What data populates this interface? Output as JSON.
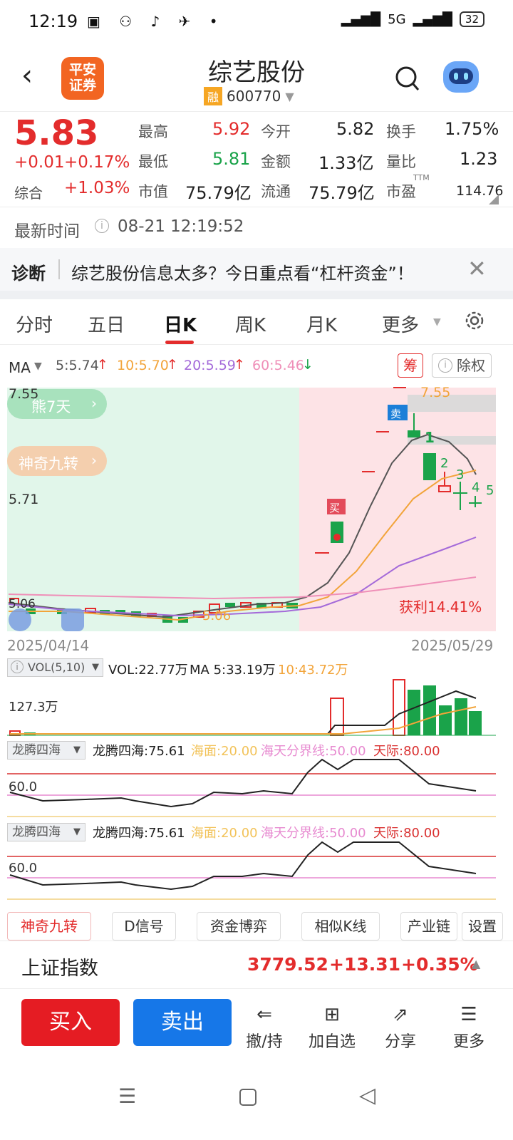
{
  "status_bar": {
    "time": "12:19",
    "network": "5G",
    "battery": "32"
  },
  "header": {
    "logo_text": "平安\n证券",
    "title": "综艺股份",
    "margin_tag": "融",
    "code": "600770"
  },
  "quote": {
    "price": "5.83",
    "change": "+0.01",
    "change_pct": "+0.17%",
    "composite_label": "综合",
    "composite_value": "+1.03%",
    "high_label": "最高",
    "high": "5.92",
    "low_label": "最低",
    "low": "5.81",
    "mktcap_label": "市值",
    "mktcap": "75.79亿",
    "open_label": "今开",
    "open": "5.82",
    "amount_label": "金额",
    "amount": "1.33亿",
    "float_label": "流通",
    "float_cap": "75.79亿",
    "turnover_label": "换手",
    "turnover": "1.75%",
    "volratio_label": "量比",
    "volratio": "1.23",
    "pe_label": "市盈",
    "pe_sup": "TTM",
    "pe": "114.76"
  },
  "latest_time": {
    "label": "最新时间",
    "value": "08-21 12:19:52"
  },
  "diagnosis": {
    "label": "诊断",
    "text": "综艺股份信息太多？今日重点看“杠杆资金”！"
  },
  "tabs": [
    "分时",
    "五日",
    "日K",
    "周K",
    "月K",
    "更多"
  ],
  "active_tab": "日K",
  "ma_row": {
    "label": "MA",
    "ma5": "5:5.74",
    "ma10": "10:5.70",
    "ma20": "20:5.59",
    "ma60": "60:5.46",
    "chou_label": "筹",
    "adjust_label": "除权"
  },
  "kline": {
    "high_label": "7.55",
    "mid_label": "5.71",
    "low_label": "5.06",
    "bear_tag": "熊7天",
    "nine_tag": "神奇九转",
    "buy_tag": "买",
    "sell_tag": "卖",
    "profit_text": "获利14.41%",
    "peak_label": "7.55",
    "low_point_label": "5.06",
    "counts": [
      "1",
      "2",
      "3",
      "4",
      "5"
    ],
    "date_start": "2025/04/14",
    "date_end": "2025/05/29"
  },
  "volume": {
    "selector": "VOL(5,10)",
    "vol": "VOL:22.77万",
    "ma5": "MA 5:33.19万",
    "ma10": "10:43.72万",
    "axis_label": "127.3万"
  },
  "indicator": {
    "selector": "龙腾四海",
    "value": "龙腾四海:75.61",
    "sea": "海面:20.00",
    "boundary": "海天分界线:50.00",
    "sky": "天际:80.00",
    "axis_label": "60.0"
  },
  "tool_buttons": [
    "神奇九转",
    "D信号",
    "资金博弈",
    "相似K线",
    "产业链",
    "设置"
  ],
  "index_bar": {
    "name": "上证指数",
    "value": "3779.52",
    "change": "+13.31",
    "pct": "+0.35%"
  },
  "actions": {
    "buy": "买入",
    "sell": "卖出",
    "hold": "撤/持",
    "watch": "加自选",
    "share": "分享",
    "more": "更多"
  },
  "colors": {
    "up": "#e32c2c",
    "down": "#1aa34a",
    "ma5": "#555555",
    "ma10": "#f2a43a",
    "ma20": "#a46ad9",
    "ma60": "#ef8fb8"
  }
}
